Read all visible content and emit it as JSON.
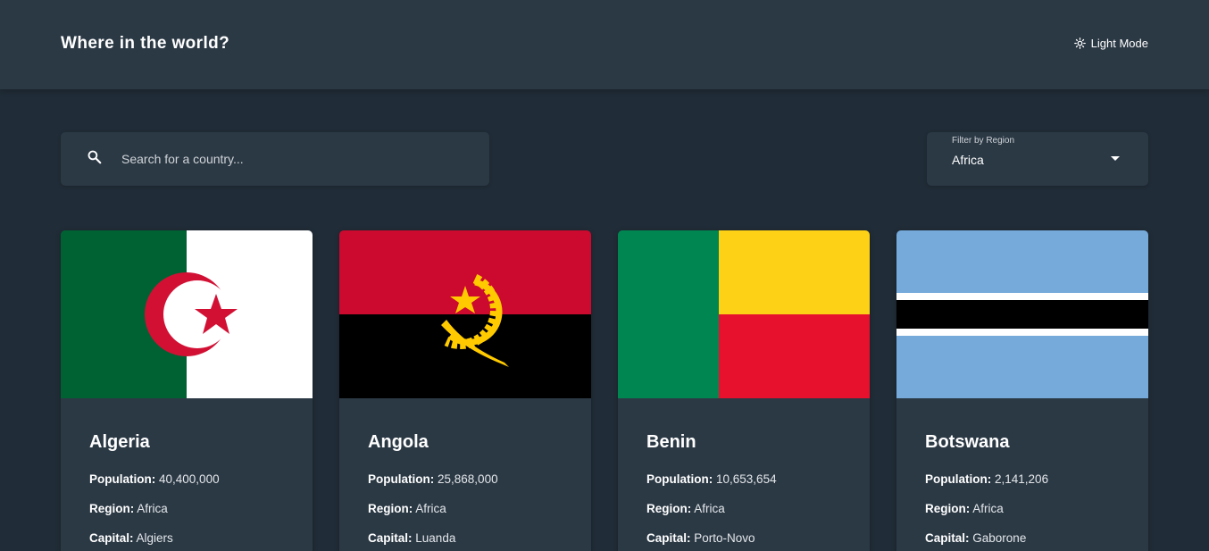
{
  "header": {
    "title": "Where in the world?",
    "theme_toggle_label": "Light Mode",
    "theme_icon": "sun-icon"
  },
  "search": {
    "placeholder": "Search for a country...",
    "value": "",
    "icon": "search-icon"
  },
  "filter": {
    "label": "Filter by Region",
    "value": "Africa",
    "icon": "caret-down-icon"
  },
  "labels": {
    "population": "Population:",
    "region": "Region:",
    "capital": "Capital:"
  },
  "countries": [
    {
      "name": "Algeria",
      "population": "40,400,000",
      "region": "Africa",
      "capital": "Algiers",
      "flag": "algeria-flag"
    },
    {
      "name": "Angola",
      "population": "25,868,000",
      "region": "Africa",
      "capital": "Luanda",
      "flag": "angola-flag"
    },
    {
      "name": "Benin",
      "population": "10,653,654",
      "region": "Africa",
      "capital": "Porto-Novo",
      "flag": "benin-flag"
    },
    {
      "name": "Botswana",
      "population": "2,141,206",
      "region": "Africa",
      "capital": "Gaborone",
      "flag": "botswana-flag"
    }
  ],
  "colors": {
    "background": "#202c37",
    "element": "#2b3945",
    "text": "#ffffff"
  }
}
